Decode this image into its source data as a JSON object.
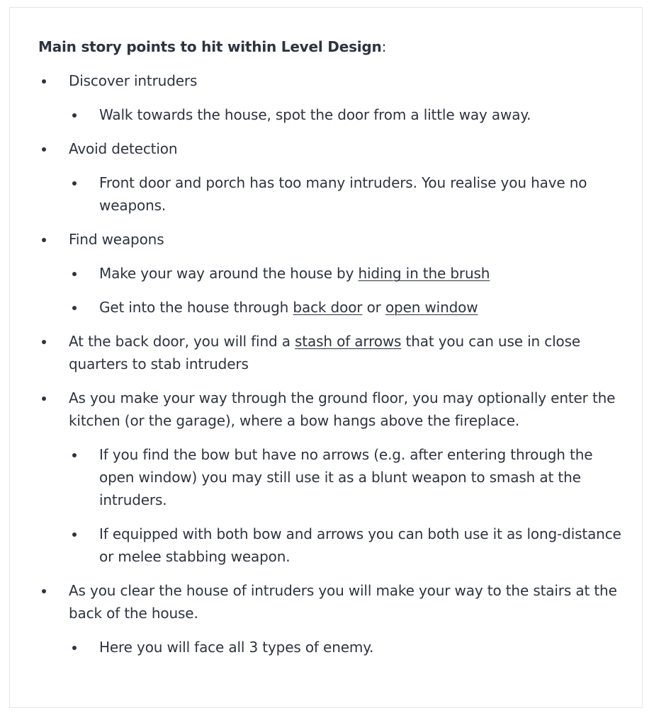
{
  "heading": {
    "bold": "Main story points to hit within Level Design",
    "suffix": ":"
  },
  "items": [
    {
      "text": "Discover intruders"
    },
    {
      "text": "Walk towards the house, spot the door from a little way away."
    },
    {
      "text": "Avoid detection"
    },
    {
      "text": "Front door and porch has too many intruders. You realise you have no weapons."
    },
    {
      "text": "Find weapons"
    },
    {
      "pre": "Make your way around the house by ",
      "link": "hiding in the brush"
    },
    {
      "pre": "Get into the house through ",
      "link1": "back door",
      "mid": " or ",
      "link2": "open window"
    },
    {
      "pre": "At the back door, you will find a ",
      "link": "stash of arrows",
      "post": " that you can use in close quarters to stab intruders"
    },
    {
      "text": "As you make your way through the ground floor, you may optionally enter the kitchen (or the garage), where a bow hangs above the fireplace."
    },
    {
      "text": "If you find the bow but have no arrows (e.g. after entering through the open window) you may still use it as a blunt weapon to smash at the intruders."
    },
    {
      "text": "If equipped with both bow and arrows you can both use it as long-distance or melee stabbing weapon."
    },
    {
      "text": "As you clear the house of intruders you will make your way to the stairs at the back of the house."
    },
    {
      "text": "Here you will face all 3 types of enemy."
    }
  ]
}
